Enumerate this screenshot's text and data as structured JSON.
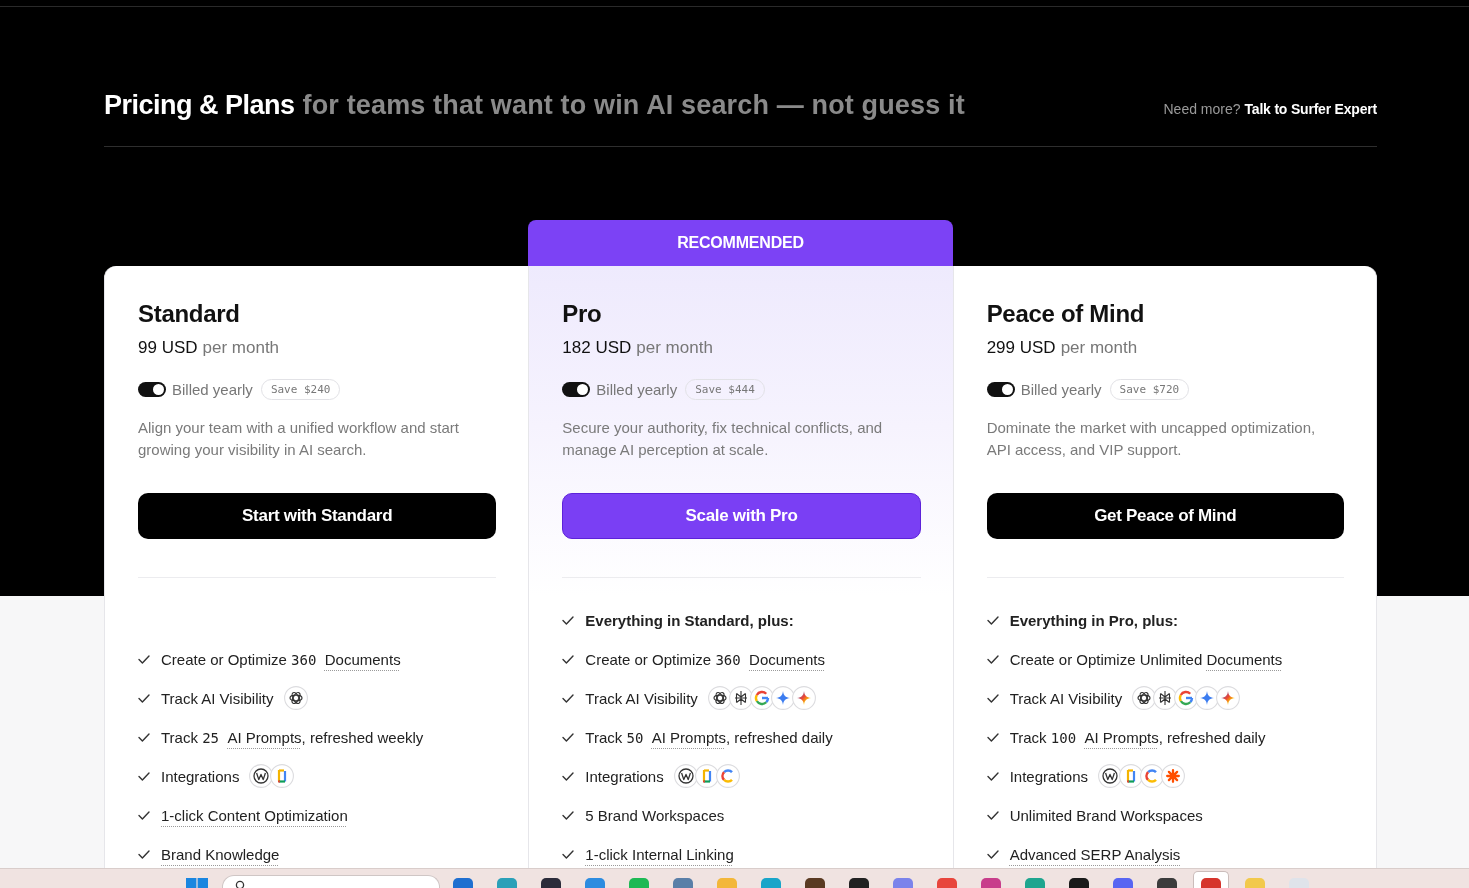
{
  "header": {
    "title": "Pricing & Plans",
    "tagline": "for teams that want to win AI search — not guess it",
    "help_prompt": "Need more?",
    "help_link": "Talk to Surfer Expert"
  },
  "plans": [
    {
      "name": "Standard",
      "recommended": false,
      "price": "99 USD",
      "period": "per month",
      "billing": {
        "label": "Billed yearly",
        "on": true,
        "savings": "Save $240"
      },
      "description": "Align your team with a unified workflow and start growing your visibility in AI search.",
      "cta": "Start with Standard",
      "features": [
        {
          "kind": "item",
          "parts": [
            {
              "kind": "text",
              "text": "Create or Optimize "
            },
            {
              "kind": "count",
              "text": "360 "
            },
            {
              "kind": "term",
              "text": "Documents"
            }
          ]
        },
        {
          "kind": "item",
          "parts": [
            {
              "kind": "text",
              "text": "Track AI Visibility"
            }
          ],
          "logos": [
            {
              "kind": "knot"
            }
          ]
        },
        {
          "kind": "item",
          "parts": [
            {
              "kind": "text",
              "text": "Track "
            },
            {
              "kind": "count",
              "text": "25 "
            },
            {
              "kind": "term",
              "text": "AI Prompts"
            },
            {
              "kind": "text",
              "text": ", refreshed weekly"
            }
          ]
        },
        {
          "kind": "item",
          "parts": [
            {
              "kind": "text",
              "text": "Integrations"
            }
          ],
          "logos": [
            {
              "kind": "w-mark"
            },
            {
              "kind": "doc"
            }
          ]
        },
        {
          "kind": "item",
          "parts": [
            {
              "kind": "term",
              "text": "1-click Content Optimization"
            }
          ]
        },
        {
          "kind": "item",
          "parts": [
            {
              "kind": "term",
              "text": "Brand Knowledge"
            }
          ]
        }
      ]
    },
    {
      "name": "Pro",
      "recommended": true,
      "banner": "RECOMMENDED",
      "price": "182 USD",
      "period": "per month",
      "billing": {
        "label": "Billed yearly",
        "on": true,
        "savings": "Save $444"
      },
      "description": "Secure your authority, fix technical conflicts, and manage AI perception at scale.",
      "cta": "Scale with Pro",
      "features": [
        {
          "kind": "intro",
          "text": "Everything in Standard, plus:"
        },
        {
          "kind": "item",
          "parts": [
            {
              "kind": "text",
              "text": "Create or Optimize "
            },
            {
              "kind": "count",
              "text": "360 "
            },
            {
              "kind": "term",
              "text": "Documents"
            }
          ]
        },
        {
          "kind": "item",
          "parts": [
            {
              "kind": "text",
              "text": "Track AI Visibility"
            }
          ],
          "logos": [
            {
              "kind": "knot"
            },
            {
              "kind": "spider"
            },
            {
              "kind": "letter-g"
            },
            {
              "kind": "star"
            },
            {
              "kind": "sparkle"
            }
          ]
        },
        {
          "kind": "item",
          "parts": [
            {
              "kind": "text",
              "text": "Track "
            },
            {
              "kind": "count",
              "text": "50 "
            },
            {
              "kind": "term",
              "text": "AI Prompts"
            },
            {
              "kind": "text",
              "text": ", refreshed daily"
            }
          ]
        },
        {
          "kind": "item",
          "parts": [
            {
              "kind": "text",
              "text": "Integrations"
            }
          ],
          "logos": [
            {
              "kind": "w-mark"
            },
            {
              "kind": "doc"
            },
            {
              "kind": "letter-c"
            }
          ]
        },
        {
          "kind": "item",
          "parts": [
            {
              "kind": "text",
              "text": "5 Brand Workspaces"
            }
          ]
        },
        {
          "kind": "item",
          "parts": [
            {
              "kind": "term",
              "text": "1-click Internal Linking"
            }
          ]
        }
      ]
    },
    {
      "name": "Peace of Mind",
      "recommended": false,
      "price": "299 USD",
      "period": "per month",
      "billing": {
        "label": "Billed yearly",
        "on": true,
        "savings": "Save $720"
      },
      "description": "Dominate the market with uncapped optimization, API access, and VIP support.",
      "cta": "Get Peace of Mind",
      "features": [
        {
          "kind": "intro",
          "text": "Everything in Pro, plus:"
        },
        {
          "kind": "item",
          "parts": [
            {
              "kind": "text",
              "text": "Create or Optimize Unlimited "
            },
            {
              "kind": "term",
              "text": "Documents"
            }
          ]
        },
        {
          "kind": "item",
          "parts": [
            {
              "kind": "text",
              "text": "Track AI Visibility"
            }
          ],
          "logos": [
            {
              "kind": "knot"
            },
            {
              "kind": "spider"
            },
            {
              "kind": "letter-g"
            },
            {
              "kind": "star"
            },
            {
              "kind": "sparkle"
            }
          ]
        },
        {
          "kind": "item",
          "parts": [
            {
              "kind": "text",
              "text": "Track "
            },
            {
              "kind": "count",
              "text": "100 "
            },
            {
              "kind": "term",
              "text": "AI Prompts"
            },
            {
              "kind": "text",
              "text": ", refreshed daily"
            }
          ]
        },
        {
          "kind": "item",
          "parts": [
            {
              "kind": "text",
              "text": "Integrations"
            }
          ],
          "logos": [
            {
              "kind": "w-mark"
            },
            {
              "kind": "doc"
            },
            {
              "kind": "letter-c"
            },
            {
              "kind": "asterisk"
            }
          ]
        },
        {
          "kind": "item",
          "parts": [
            {
              "kind": "text",
              "text": "Unlimited Brand Workspaces"
            }
          ]
        },
        {
          "kind": "item",
          "parts": [
            {
              "kind": "term",
              "text": "Advanced SERP Analysis"
            }
          ]
        }
      ]
    }
  ],
  "taskbar": {
    "apps": [
      {
        "color": "#1f6fd0",
        "selected": false
      },
      {
        "color": "#2aa0b8",
        "selected": false
      },
      {
        "color": "#2b2b3a",
        "selected": false
      },
      {
        "color": "#2d8ce0",
        "selected": false
      },
      {
        "color": "#1db954",
        "selected": false
      },
      {
        "color": "#5a7fa8",
        "selected": false
      },
      {
        "color": "#f3b73a",
        "selected": false
      },
      {
        "color": "#19a5c9",
        "selected": false
      },
      {
        "color": "#5a3a22",
        "selected": false
      },
      {
        "color": "#222222",
        "selected": false
      },
      {
        "color": "#7b83eb",
        "selected": false
      },
      {
        "color": "#e8453c",
        "selected": false
      },
      {
        "color": "#c83d8b",
        "selected": false
      },
      {
        "color": "#1fa58f",
        "selected": false
      },
      {
        "color": "#1a1a1a",
        "selected": false
      },
      {
        "color": "#5865f2",
        "selected": false
      },
      {
        "color": "#3c3c3c",
        "selected": false
      },
      {
        "color": "#d6342c",
        "selected": true
      },
      {
        "color": "#f2c94c",
        "selected": false
      },
      {
        "color": "#dfe3ea",
        "selected": false
      }
    ]
  }
}
